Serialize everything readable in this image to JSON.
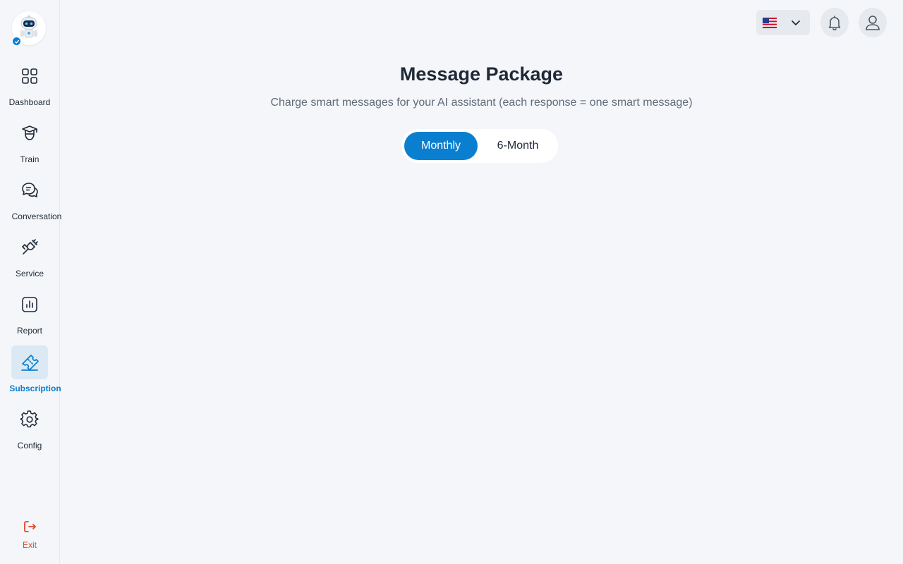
{
  "sidebar": {
    "items": [
      {
        "label": "Dashboard",
        "icon": "grid-icon"
      },
      {
        "label": "Train",
        "icon": "graduate-icon"
      },
      {
        "label": "Conversation",
        "icon": "chat-icon"
      },
      {
        "label": "Service",
        "icon": "plug-icon"
      },
      {
        "label": "Report",
        "icon": "chart-icon"
      },
      {
        "label": "Subscription",
        "icon": "ticket-icon",
        "active": true
      },
      {
        "label": "Config",
        "icon": "gear-icon"
      }
    ],
    "exit_label": "Exit"
  },
  "topbar": {
    "language_flag": "🇺🇸"
  },
  "main": {
    "title": "Message Package",
    "subtitle": "Charge smart messages for your AI assistant (each response = one smart message)",
    "billing_toggle": {
      "options": [
        "Monthly",
        "6-Month"
      ],
      "selected": "Monthly"
    }
  },
  "colors": {
    "accent": "#0a7fd0",
    "exit": "#e3452b",
    "background": "#f4f6f9"
  }
}
